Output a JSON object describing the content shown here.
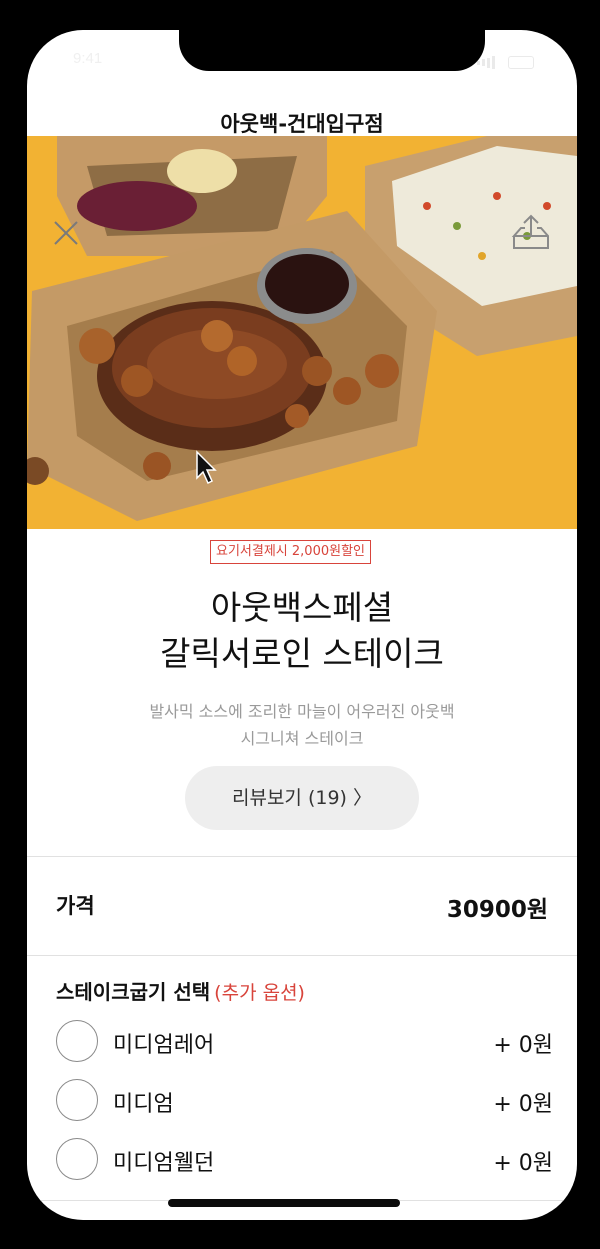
{
  "status": {
    "time": "9:41"
  },
  "header": {
    "title": "아웃백-건대입구점"
  },
  "menu": {
    "discount_badge": "요기서결제시 2,000원할인",
    "title_line1": "아웃백스페셜",
    "title_line2": "갈릭서로인 스테이크",
    "desc_line1": "발사믹 소스에 조리한 마늘이 어우러진 아웃백",
    "desc_line2": "시그니쳐 스테이크",
    "review_label": "리뷰보기 (19) 〉"
  },
  "price": {
    "label": "가격",
    "value": "30900원"
  },
  "options": {
    "title": "스테이크굽기 선택",
    "extra_label": "(추가 옵션)",
    "items": [
      {
        "label": "미디엄레어",
        "price": "+ 0원"
      },
      {
        "label": "미디엄",
        "price": "+ 0원"
      },
      {
        "label": "미디엄웰던",
        "price": "+ 0원"
      }
    ]
  },
  "icons": {
    "close": "close-icon",
    "share": "share-icon",
    "cursor": "mouse-cursor-icon"
  },
  "colors": {
    "accent_red": "#d8443b",
    "hero_background": "#f2b233",
    "review_button_bg": "#eeeeee"
  }
}
